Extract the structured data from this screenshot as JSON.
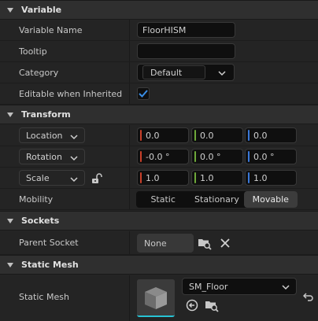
{
  "variable": {
    "title": "Variable",
    "name_label": "Variable Name",
    "name_value": "FloorHISM",
    "tooltip_label": "Tooltip",
    "tooltip_value": "",
    "category_label": "Category",
    "category_value": "Default",
    "editable_label": "Editable when Inherited",
    "editable_checked": true
  },
  "transform": {
    "title": "Transform",
    "location": {
      "label": "Location",
      "x": "0.0",
      "y": "0.0",
      "z": "0.0"
    },
    "rotation": {
      "label": "Rotation",
      "x": "-0.0 °",
      "y": "0.0 °",
      "z": "0.0 °"
    },
    "scale": {
      "label": "Scale",
      "x": "1.0",
      "y": "1.0",
      "z": "1.0"
    },
    "mobility_label": "Mobility",
    "mobility_options": [
      "Static",
      "Stationary",
      "Movable"
    ],
    "mobility_selected": "Movable"
  },
  "sockets": {
    "title": "Sockets",
    "parent_label": "Parent Socket",
    "parent_value": "None"
  },
  "static_mesh": {
    "title": "Static Mesh",
    "label": "Static Mesh",
    "value": "SM_Floor"
  },
  "colors": {
    "x_axis": "#c9402a",
    "y_axis": "#6ea83a",
    "z_axis": "#3a78d8",
    "thumbnail_accent": "#27c3d4",
    "checkbox_check": "#3a8ee6"
  }
}
